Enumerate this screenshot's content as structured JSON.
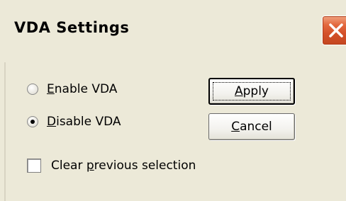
{
  "window": {
    "title": "VDA Settings"
  },
  "options": {
    "enable": {
      "prefix": "",
      "accel": "E",
      "rest": "nable VDA",
      "checked": false
    },
    "disable": {
      "prefix": "",
      "accel": "D",
      "rest": "isable VDA",
      "checked": true
    }
  },
  "buttons": {
    "apply": {
      "prefix": "",
      "accel": "A",
      "rest": "pply"
    },
    "cancel": {
      "prefix": "",
      "accel": "C",
      "rest": "ancel"
    }
  },
  "clear": {
    "prefix": "Clear ",
    "accel": "p",
    "rest": "revious selection",
    "checked": false
  },
  "colors": {
    "face": "#ece9d8",
    "close_button": "#d4512a"
  }
}
